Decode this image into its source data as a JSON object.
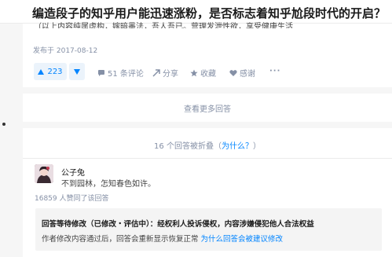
{
  "page_title": "编造段子的知乎用户能迅速涨粉，是否标志着知乎尬段时代的开启？",
  "answer": {
    "cut_text": "（以上内容纯属虚构，嫁暗墨法，吾人吾已。营理发泄性欲，享受健康生活",
    "date": "发布于 2017-08-12",
    "vote_count": "223",
    "actions": {
      "comments": "51 条评论",
      "share": "分享",
      "favorite": "收藏",
      "thanks": "感谢",
      "more": "···"
    }
  },
  "more_answers_label": "查看更多回答",
  "folded": {
    "header": "16 个回答被折叠",
    "why_open": "（",
    "why_label": "为什么？",
    "why_close": "）",
    "author": "公子兔",
    "excerpt": "不到园林，怎知春色如许。",
    "agree_count": "16859 人赞同了该回答",
    "notice_title": "回答等待修改（已修改・评估中）：经权利人投诉侵权，内容涉嫌侵犯他人合法权益",
    "notice_body": "作者修改内容通过后，回答会重新显示恢复正常",
    "notice_link": "为什么回答会被建议修改"
  },
  "colors": {
    "accent": "#0084ff",
    "muted": "#8590a6",
    "vote_bg": "#ebf3fb"
  }
}
